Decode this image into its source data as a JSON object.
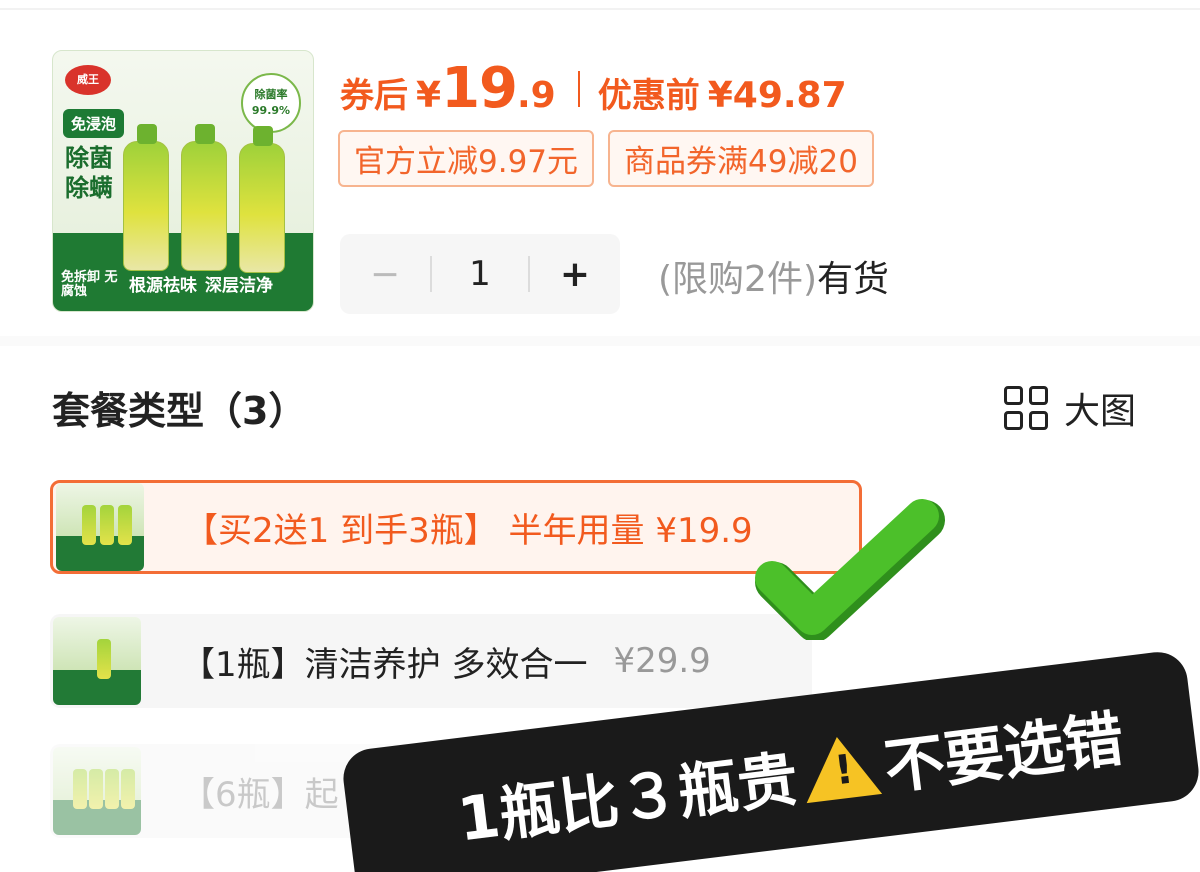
{
  "product": {
    "thumb": {
      "brand": "威王",
      "pct_label": "除菌率",
      "pct_value": "99.9%",
      "tag": "免浸泡",
      "headline": "除菌除螨",
      "foot_left": "免拆卸 无腐蚀",
      "foot_mid": "根源祛味",
      "foot_right": "深层洁净"
    },
    "price_label": "券后",
    "currency": "¥",
    "price_int": "19",
    "price_dec": ".9",
    "orig_label": "优惠前",
    "orig_price": "¥49.87",
    "chips": [
      "官方立减9.97元",
      "商品券满49减20"
    ]
  },
  "quantity": {
    "minus": "−",
    "value": "1",
    "plus": "+",
    "limit": "(限购2件)",
    "availability": "有货"
  },
  "section": {
    "title": "套餐类型（3）",
    "view_label": "大图"
  },
  "options": [
    {
      "label": "【买2送1 到手3瓶】 半年用量 ¥19.9",
      "selected": true
    },
    {
      "label": "【1瓶】清洁养护 多效合一",
      "price": "¥29.9",
      "selected": false
    },
    {
      "label": "【6瓶】起",
      "selected": false
    }
  ],
  "overlay": {
    "text_before": "1瓶比３瓶贵",
    "warn_mark": "!",
    "text_after": "不要选错"
  },
  "colors": {
    "accent": "#f25a1e",
    "check": "#4cc02a",
    "banner": "#1a1a1a"
  }
}
